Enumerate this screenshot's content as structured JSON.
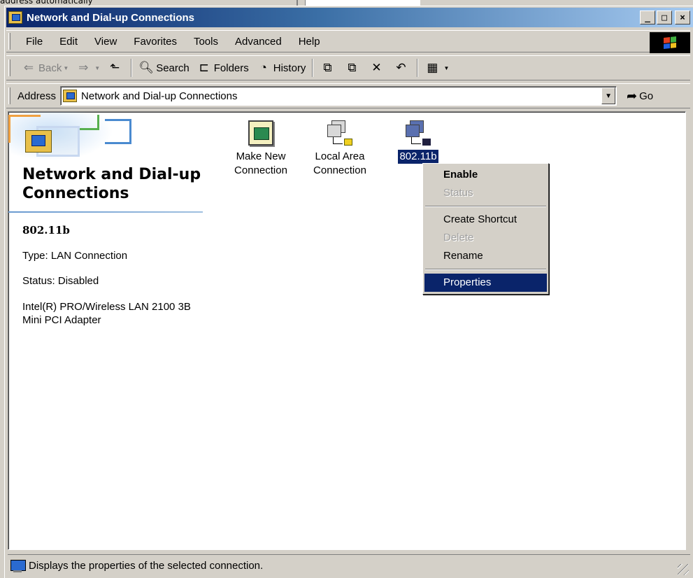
{
  "background_window": {
    "text": "address automatically"
  },
  "window": {
    "title": "Network and Dial-up Connections",
    "controls": {
      "minimize": "_",
      "maximize": "□",
      "close": "×"
    }
  },
  "menubar": {
    "items": [
      "File",
      "Edit",
      "View",
      "Favorites",
      "Tools",
      "Advanced",
      "Help"
    ]
  },
  "toolbar": {
    "back": "Back",
    "search": "Search",
    "folders": "Folders",
    "history": "History"
  },
  "addressbar": {
    "label": "Address",
    "value": "Network and Dial-up Connections",
    "go": "Go"
  },
  "left_panel": {
    "title": "Network and Dial-up Connections",
    "selected_name": "802.11b",
    "type": "Type: LAN Connection",
    "status": "Status: Disabled",
    "adapter": "Intel(R) PRO/Wireless LAN 2100 3B Mini PCI Adapter"
  },
  "icons": [
    {
      "label": "Make New Connection",
      "icon": "make-new-connection-icon"
    },
    {
      "label": "Local Area Connection",
      "icon": "lan-connection-icon"
    },
    {
      "label": "802.11b",
      "icon": "wireless-connection-icon",
      "selected": true
    }
  ],
  "context_menu": {
    "items": [
      {
        "label": "Enable",
        "state": "default-bold"
      },
      {
        "label": "Status",
        "state": "disabled"
      },
      {
        "label": "Create Shortcut",
        "state": "normal"
      },
      {
        "label": "Delete",
        "state": "disabled"
      },
      {
        "label": "Rename",
        "state": "normal"
      },
      {
        "label": "Properties",
        "state": "highlighted"
      }
    ]
  },
  "statusbar": {
    "text": "Displays the properties of the selected connection."
  },
  "colors": {
    "title_active": "#0a246a",
    "highlight": "#0a246a",
    "face": "#d4d0c8"
  }
}
